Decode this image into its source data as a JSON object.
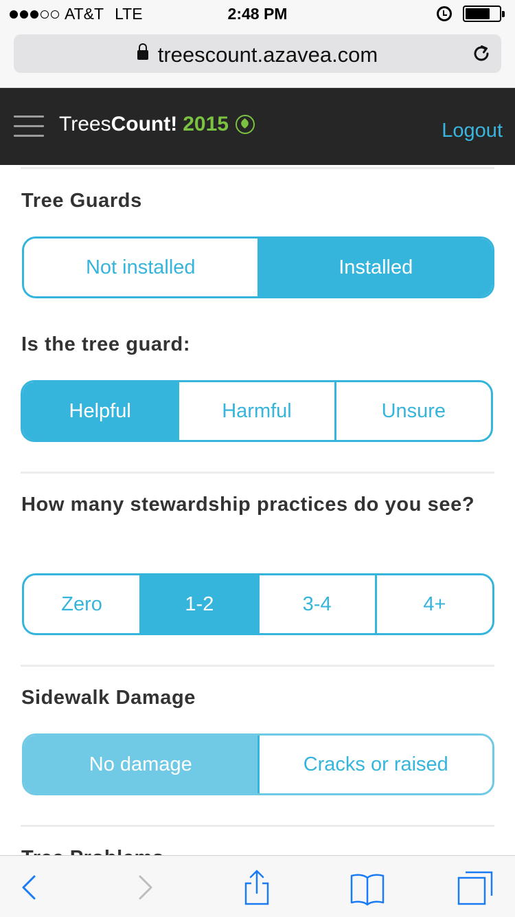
{
  "status_bar": {
    "carrier": "AT&T",
    "network": "LTE",
    "time": "2:48 PM",
    "signal_bars_filled": 3,
    "signal_bars_total": 5,
    "battery_level": 0.72
  },
  "browser": {
    "url": "treescount.azavea.com"
  },
  "header": {
    "logo_light": "Trees",
    "logo_bold": "Count!",
    "logo_year": "2015",
    "logout_label": "Logout"
  },
  "sections": [
    {
      "title": "Tree Guards",
      "options": [
        "Not installed",
        "Installed"
      ],
      "selected": 1
    },
    {
      "title": "Is the tree guard:",
      "options": [
        "Helpful",
        "Harmful",
        "Unsure"
      ],
      "selected": 0
    },
    {
      "title": "How many stewardship practices do you see?",
      "options": [
        "Zero",
        "1-2",
        "3-4",
        "4+"
      ],
      "selected": 1
    },
    {
      "title": "Sidewalk Damage",
      "options": [
        "No damage",
        "Cracks or raised"
      ],
      "selected": 0
    },
    {
      "title": "Tree Problems"
    }
  ],
  "colors": {
    "accent": "#36b5dc",
    "accent_light": "#70c9e5",
    "header_bg": "#262626",
    "brand_green": "#7cc242",
    "text": "#333333"
  },
  "icons": {
    "toolbar": [
      "back-icon",
      "forward-icon",
      "share-icon",
      "bookmarks-icon",
      "tabs-icon"
    ]
  }
}
